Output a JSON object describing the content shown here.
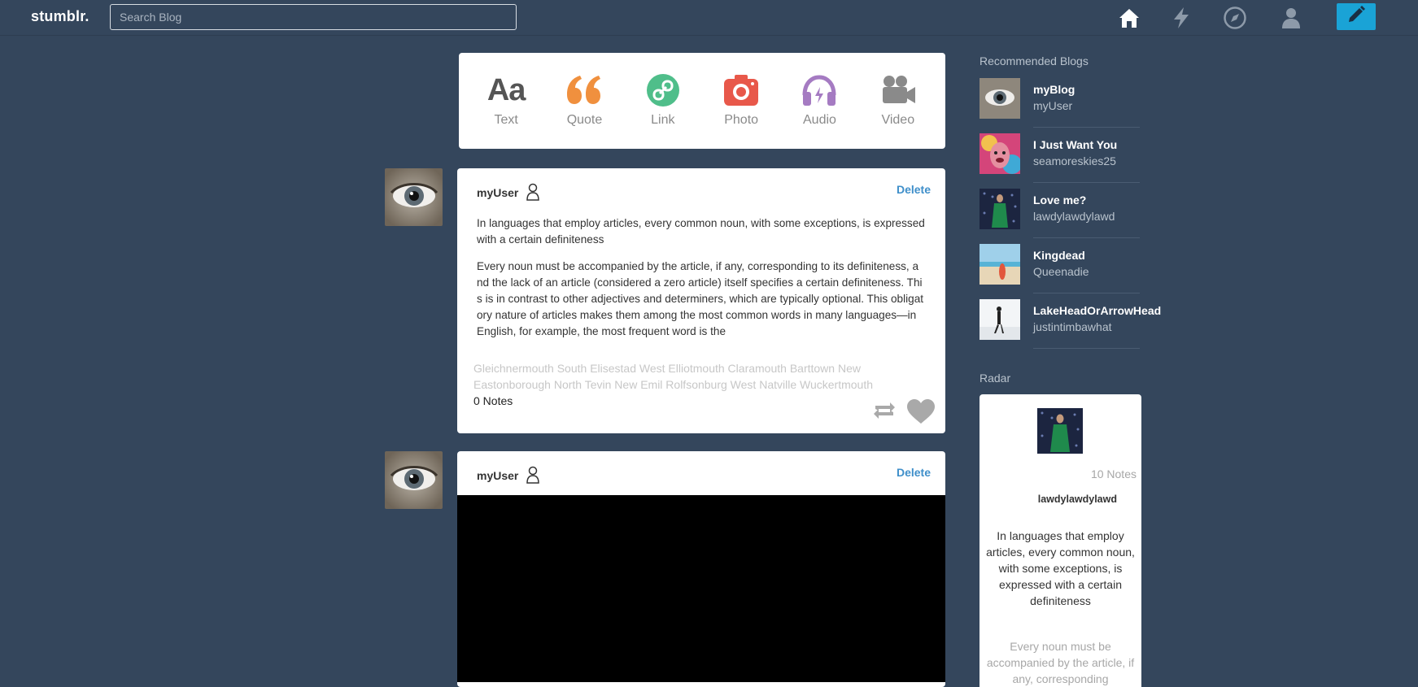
{
  "header": {
    "logo": "stumblr.",
    "search_placeholder": "Search Blog"
  },
  "post_types": [
    {
      "label": "Text",
      "icon": "text-icon",
      "color": "#555555"
    },
    {
      "label": "Quote",
      "icon": "quote-icon",
      "color": "#f0903e"
    },
    {
      "label": "Link",
      "icon": "link-icon",
      "color": "#4fbe8a"
    },
    {
      "label": "Photo",
      "icon": "camera-icon",
      "color": "#e8584a"
    },
    {
      "label": "Audio",
      "icon": "headphones-icon",
      "color": "#a57bc2"
    },
    {
      "label": "Video",
      "icon": "video-camera-icon",
      "color": "#8a8a8a"
    }
  ],
  "posts": [
    {
      "author": "myUser",
      "delete_label": "Delete",
      "text_1": "In languages that employ articles, every common noun, with some exceptions, is expressed with a certain definiteness",
      "text_2": "Every noun must be accompanied by the article, if any, corresponding to its definiteness, and the lack of an article (considered a zero article) itself specifies a certain definiteness. This is in contrast to other adjectives and determiners, which are typically optional. This obligatory nature of articles makes them among the most common words in many languages—in English, for example, the most frequent word is the",
      "tags": "Gleichnermouth South Elisestad West Elliotmouth Claramouth Barttown New Eastonborough North Tevin New Emil Rolfsonburg West Natville Wuckertmouth",
      "notes": "0 Notes"
    },
    {
      "author": "myUser",
      "delete_label": "Delete"
    }
  ],
  "sidebar": {
    "recommended_title": "Recommended Blogs",
    "recommended": [
      {
        "name": "myBlog",
        "handle": "myUser"
      },
      {
        "name": "I Just Want You",
        "handle": "seamoreskies25"
      },
      {
        "name": "Love me?",
        "handle": "lawdylawdylawd"
      },
      {
        "name": "Kingdead",
        "handle": "Queenadie"
      },
      {
        "name": "LakeHeadOrArrowHead",
        "handle": "justintimbawhat"
      }
    ],
    "radar_title": "Radar",
    "radar": {
      "notes": "10 Notes",
      "user": "lawdylawdylawd",
      "text_1": "In languages that employ articles, every common noun, with some exceptions, is expressed with a certain definiteness",
      "text_2": "Every noun must be accompanied by the article, if any, corresponding"
    }
  },
  "colors": {
    "background": "#34465c",
    "accent": "#1aa3d6",
    "delete_link": "#3f8fca"
  }
}
